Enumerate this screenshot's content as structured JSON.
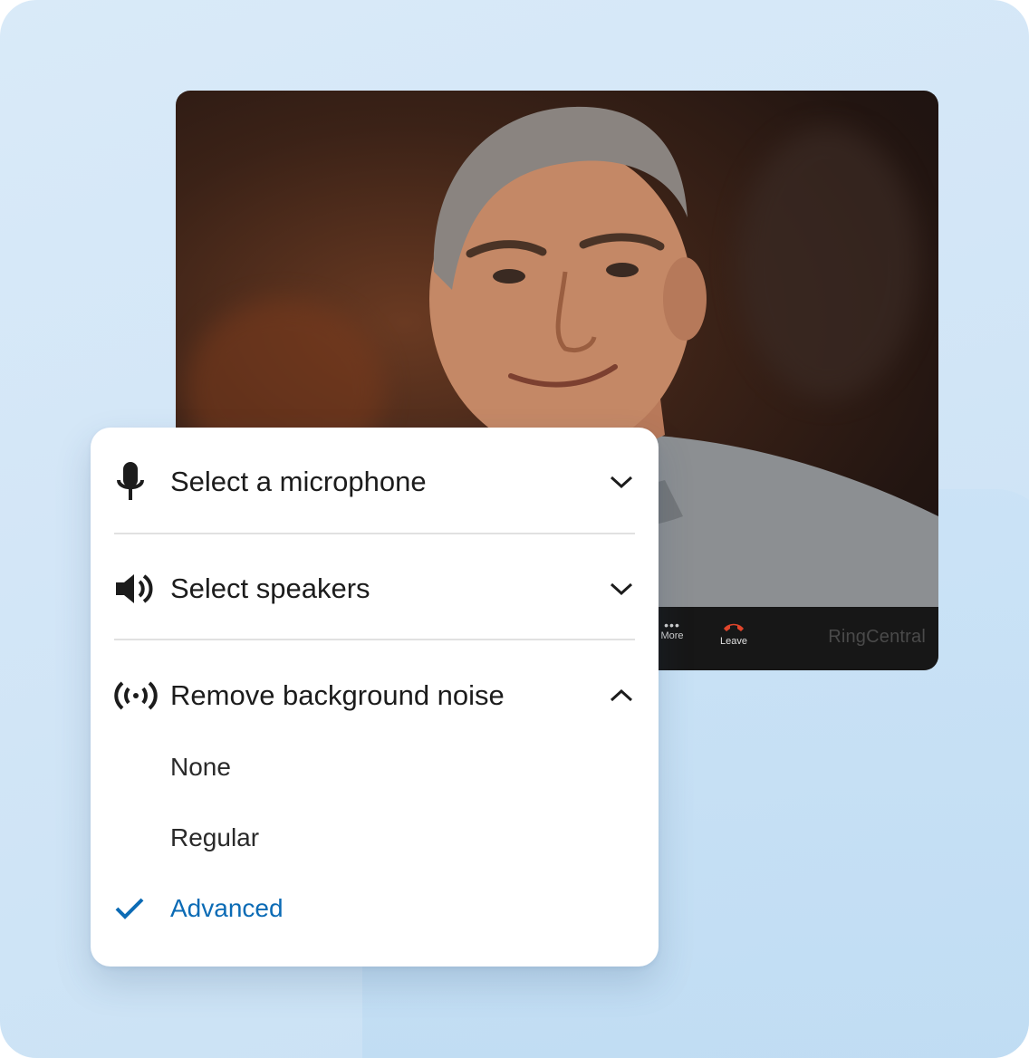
{
  "video_call": {
    "controls": {
      "more_label": "More",
      "leave_label": "Leave"
    },
    "brand": "RingCentral",
    "leave_color": "#e0452b"
  },
  "audio_settings": {
    "microphone": {
      "label": "Select a microphone",
      "icon": "microphone-icon",
      "expanded": false
    },
    "speakers": {
      "label": "Select speakers",
      "icon": "speaker-icon",
      "expanded": false
    },
    "noise": {
      "label": "Remove background noise",
      "icon": "noise-reduction-icon",
      "expanded": true,
      "options": [
        {
          "label": "None",
          "selected": false
        },
        {
          "label": "Regular",
          "selected": false
        },
        {
          "label": "Advanced",
          "selected": true
        }
      ]
    }
  },
  "colors": {
    "accent": "#0b6bb5",
    "background": "#d5e8f7"
  }
}
